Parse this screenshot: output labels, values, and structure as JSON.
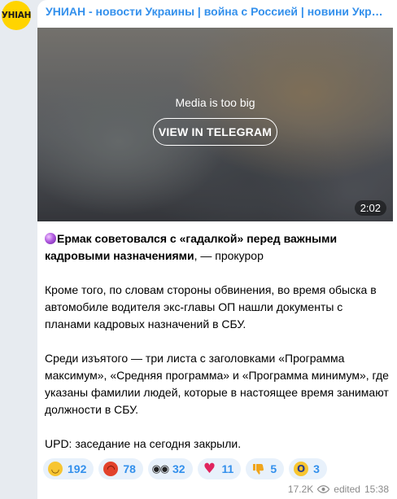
{
  "channel": {
    "avatar_text": "УНIАН",
    "title": "УНИАН - новости Украины | война с Россией | новини України | війна з Росією"
  },
  "media": {
    "notice": "Media is too big",
    "button_label": "VIEW IN TELEGRAM",
    "duration": "2:02"
  },
  "post": {
    "headline_bold": "Ермак советовался с «гадалкой» перед важными кадровыми назначениями",
    "headline_rest": ", — прокурор",
    "paragraph2": "Кроме того, по словам стороны обвинения, во время обыска в автомобиле водителя экс-главы ОП нашли документы с планами кадровых назначений в СБУ.",
    "paragraph3": "Среди изъятого — три листа с заголовками «Программа максимум», «Средняя программа» и «Программа минимум», где указаны фамилии людей, которые в настоящее время занимают должности в СБУ.",
    "paragraph4": "UPD: заседание на сегодня закрыли."
  },
  "reactions": [
    {
      "icon": "grinning-face-icon",
      "count": "192"
    },
    {
      "icon": "angry-face-icon",
      "count": "78"
    },
    {
      "icon": "eyes-icon",
      "count": "32"
    },
    {
      "icon": "red-heart-icon",
      "count": "11"
    },
    {
      "icon": "thumbs-down-icon",
      "count": "5"
    },
    {
      "icon": "screaming-face-icon",
      "count": "3"
    }
  ],
  "footer": {
    "views": "17.2K",
    "edited_label": "edited",
    "time": "15:38"
  },
  "colors": {
    "accent": "#3390ec",
    "background": "#e7ebf0",
    "reaction_bg": "#e8f1fb"
  }
}
